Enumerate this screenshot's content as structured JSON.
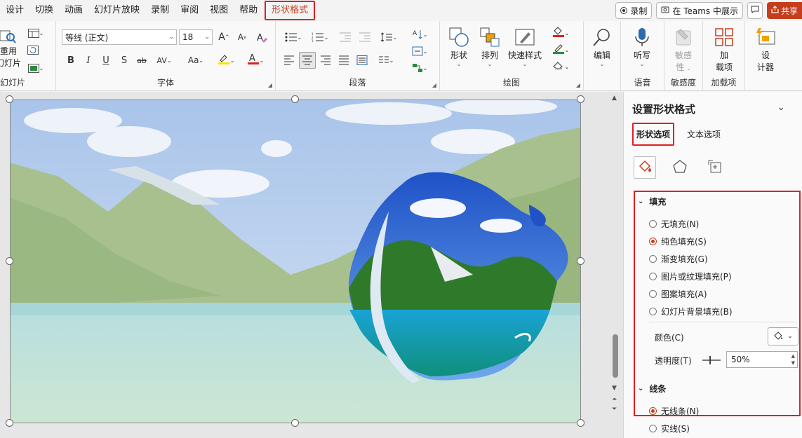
{
  "tabs": [
    "设计",
    "切换",
    "动画",
    "幻灯片放映",
    "录制",
    "审阅",
    "视图",
    "帮助"
  ],
  "active_tab": "形状格式",
  "right_tools": {
    "record_label": "录制",
    "teams_label": "在 Teams 中展示",
    "share_label": "共享"
  },
  "ribbon": {
    "slides_group": {
      "reuse_label_1": "重用",
      "reuse_label_2": "幻灯片",
      "label": "幻灯片"
    },
    "font_group": {
      "font_name": "等线 (正文)",
      "font_size": "18",
      "label": "字体",
      "bold": "B",
      "italic": "I",
      "underline": "U",
      "shadow": "S",
      "strike": "ab",
      "spacing": "AV",
      "case": "Aa",
      "grow": "A",
      "shrink": "A"
    },
    "paragraph_group": {
      "label": "段落"
    },
    "drawing_group": {
      "label": "绘图",
      "shapes_label": "形状",
      "arrange_label": "排列",
      "quick_styles_label": "快速样式"
    },
    "edit_group": {
      "label": "编辑",
      "button": "编辑"
    },
    "voice_group": {
      "label": "语音",
      "button": "听写"
    },
    "sensitivity_group": {
      "label": "敏感度",
      "button_1": "敏感",
      "button_2": "性"
    },
    "addins_group": {
      "label": "加载项",
      "button_1": "加",
      "button_2": "载项"
    },
    "designer_group": {
      "button_1": "设",
      "button_2": "计器"
    }
  },
  "pane": {
    "title": "设置形状格式",
    "tab_shape": "形状选项",
    "tab_text": "文本选项",
    "fill_section": "填充",
    "fill_options": [
      {
        "label": "无填充(N)",
        "checked": false
      },
      {
        "label": "纯色填充(S)",
        "checked": true
      },
      {
        "label": "渐变填充(G)",
        "checked": false
      },
      {
        "label": "图片或纹理填充(P)",
        "checked": false
      },
      {
        "label": "图案填充(A)",
        "checked": false
      },
      {
        "label": "幻灯片背景填充(B)",
        "checked": false
      }
    ],
    "color_label": "颜色(C)",
    "transparency_label": "透明度(T)",
    "transparency_value": "50%",
    "line_section": "线条",
    "line_options": [
      {
        "label": "无线条(N)",
        "checked": true
      },
      {
        "label": "实线(S)",
        "checked": false
      }
    ]
  },
  "colors": {
    "accent": "#c43e1c",
    "highlight_box": "#e02020",
    "highlighter_yellow": "#ffe000",
    "font_color_red": "#e02020"
  }
}
